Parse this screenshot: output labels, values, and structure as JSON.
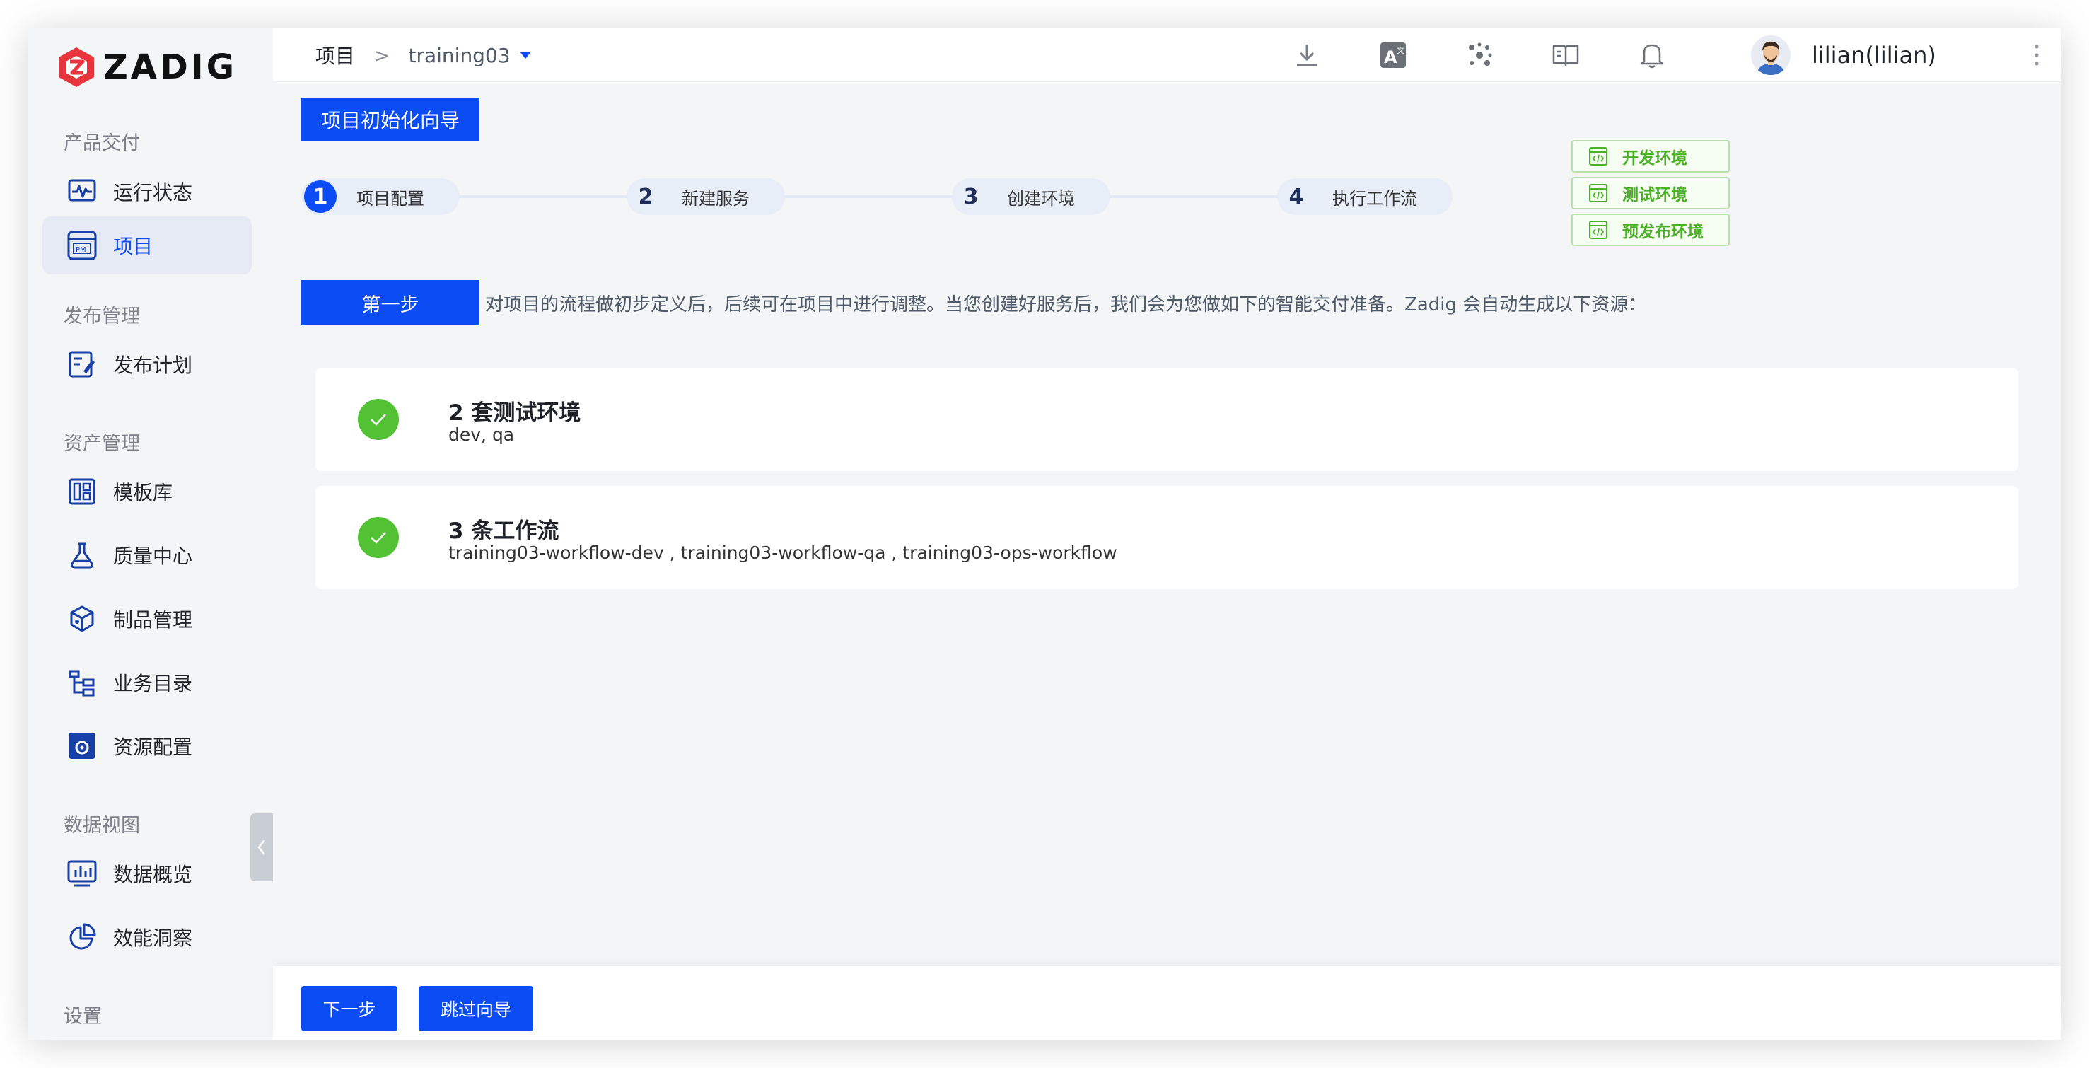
{
  "app": {
    "logo_text": "ZADIG"
  },
  "sidebar": {
    "sections": [
      {
        "title": "产品交付",
        "items": [
          {
            "label": "运行状态",
            "icon": "pulse-monitor-icon"
          },
          {
            "label": "项目",
            "icon": "project-pm-icon",
            "active": true
          }
        ]
      },
      {
        "title": "发布管理",
        "items": [
          {
            "label": "发布计划",
            "icon": "release-plan-icon"
          }
        ]
      },
      {
        "title": "资产管理",
        "items": [
          {
            "label": "模板库",
            "icon": "template-icon"
          },
          {
            "label": "质量中心",
            "icon": "flask-icon"
          },
          {
            "label": "制品管理",
            "icon": "artifact-box-icon"
          },
          {
            "label": "业务目录",
            "icon": "catalog-tree-icon"
          },
          {
            "label": "资源配置",
            "icon": "gear-icon"
          }
        ]
      },
      {
        "title": "数据视图",
        "items": [
          {
            "label": "数据概览",
            "icon": "bar-chart-icon"
          },
          {
            "label": "效能洞察",
            "icon": "pie-chart-icon"
          }
        ]
      },
      {
        "title": "设置",
        "items": []
      }
    ]
  },
  "header": {
    "breadcrumb_root": "项目",
    "breadcrumb_sep": ">",
    "project_name": "training03",
    "tools": [
      "download-icon",
      "translate-icon",
      "plugins-icon",
      "docs-book-icon",
      "bell-icon"
    ],
    "user_name": "lilian(lilian)"
  },
  "wizard": {
    "title": "项目初始化向导",
    "steps": [
      {
        "num": "1",
        "label": "项目配置",
        "active": true
      },
      {
        "num": "2",
        "label": "新建服务"
      },
      {
        "num": "3",
        "label": "创建环境"
      },
      {
        "num": "4",
        "label": "执行工作流"
      }
    ],
    "env_tags": [
      "开发环境",
      "测试环境",
      "预发布环境"
    ],
    "step_badge": "第一步",
    "step_desc": "对项目的流程做初步定义后，后续可在项目中进行调整。当您创建好服务后，我们会为您做如下的智能交付准备。Zadig 会自动生成以下资源：",
    "cards": [
      {
        "title": "2 套测试环境",
        "sub": "dev, qa"
      },
      {
        "title": "3 条工作流",
        "sub": "training03-workflow-dev , training03-workflow-qa , training03-ops-workflow"
      }
    ]
  },
  "footer": {
    "next_label": "下一步",
    "skip_label": "跳过向导"
  },
  "colors": {
    "primary": "#0b4cf5",
    "success": "#52c234",
    "background": "#f4f5f7"
  }
}
